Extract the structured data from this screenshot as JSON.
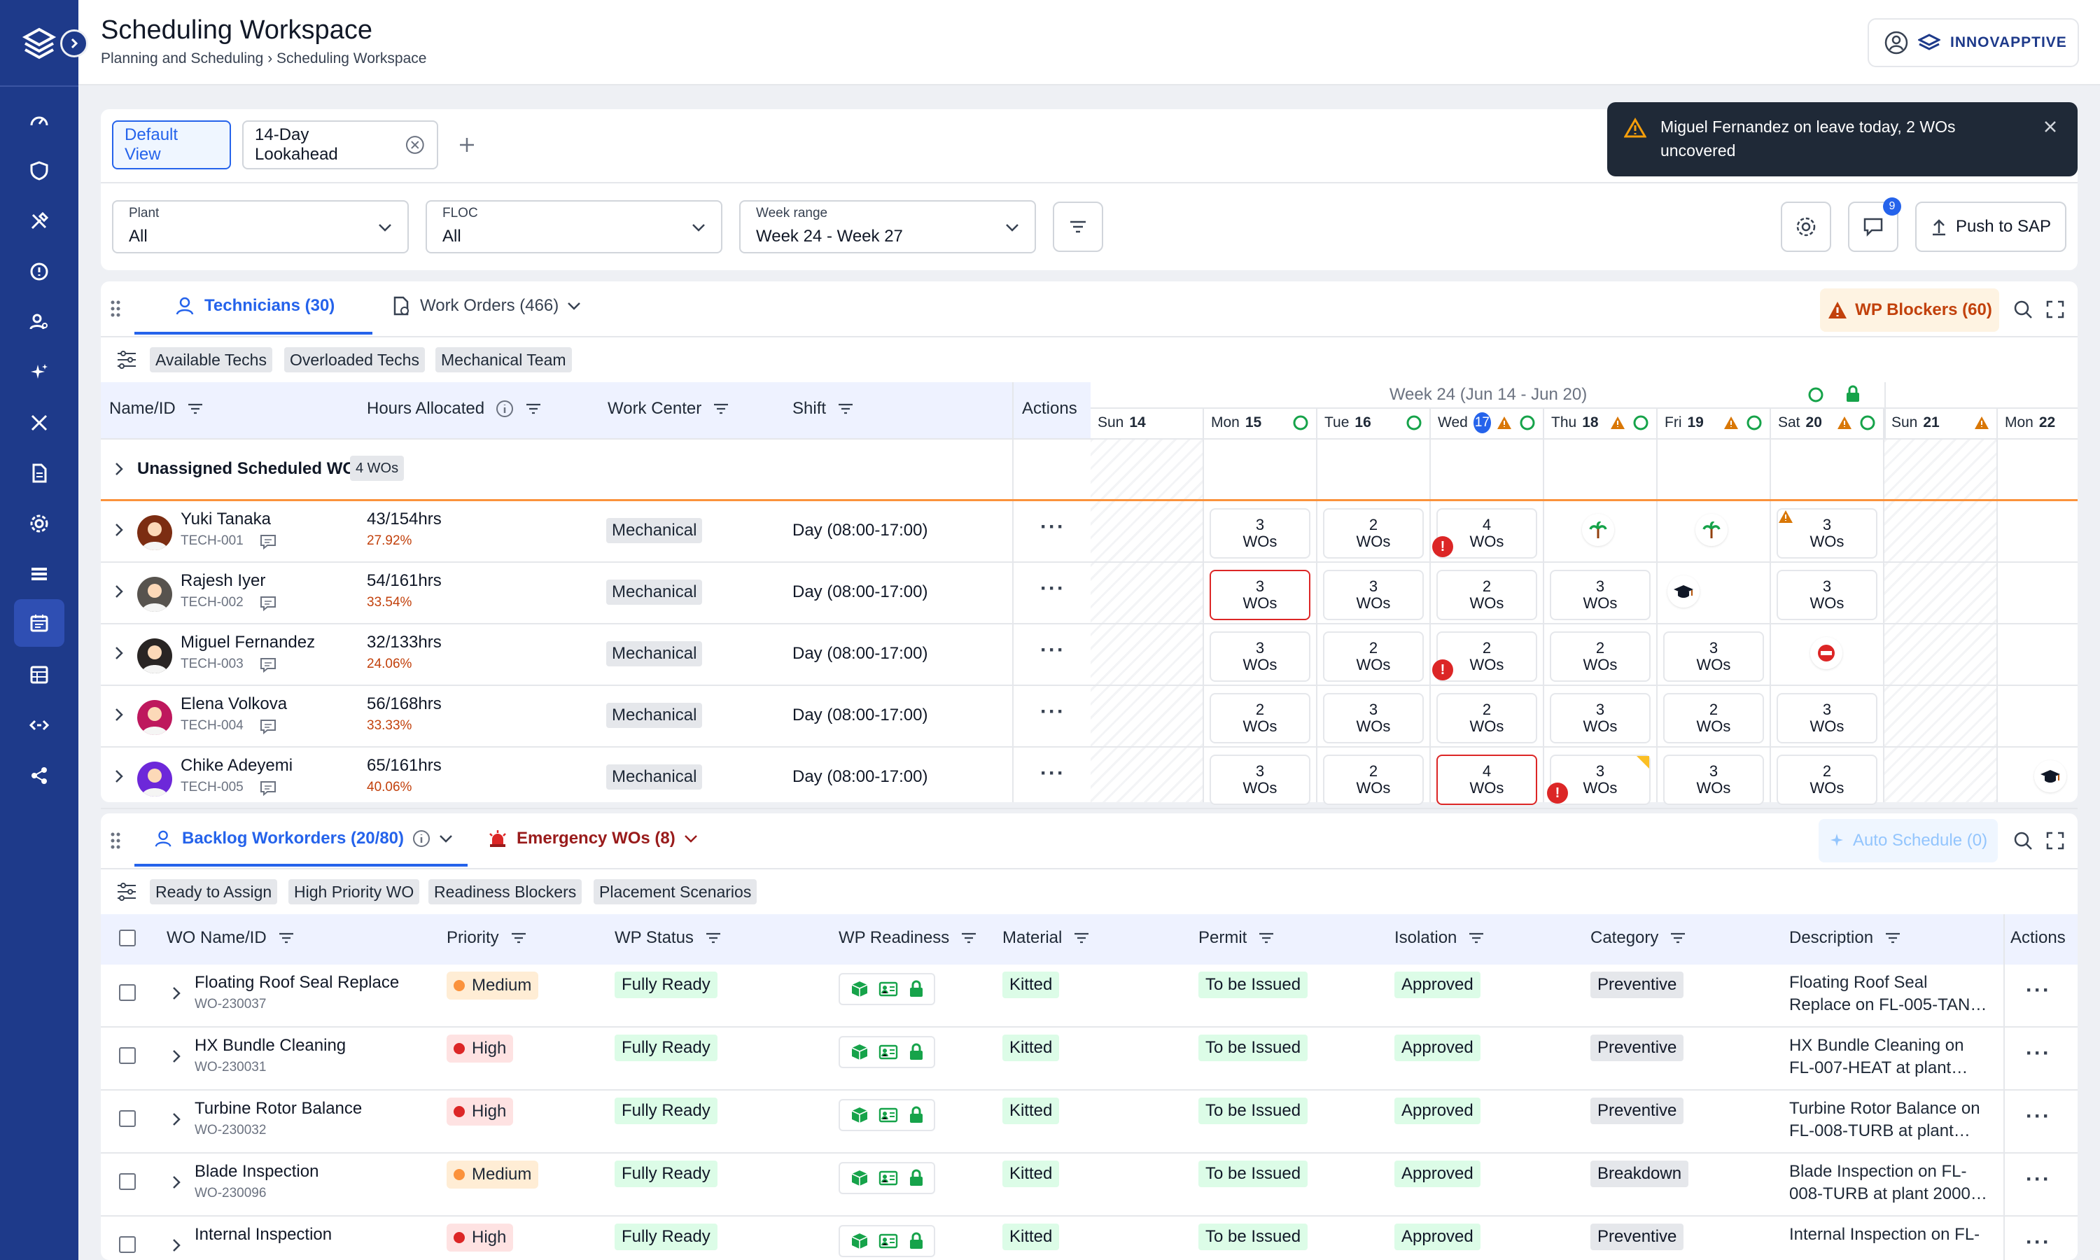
{
  "header": {
    "title": "Scheduling Workspace",
    "breadcrumb_parent": "Planning and Scheduling",
    "breadcrumb_current": "Scheduling Workspace",
    "brand": "INNOVAPPTIVE"
  },
  "toast": {
    "message_line1": "Miguel Fernandez on leave today, 2 WOs",
    "message_line2": "uncovered"
  },
  "sidebar": {
    "items": [
      "dashboard-icon",
      "shield-icon",
      "tools-icon",
      "alert-icon",
      "users-icon",
      "sparkle-icon",
      "wrench-icon",
      "document-icon",
      "settings-icon",
      "list-icon",
      "calendar-icon",
      "table-icon",
      "code-icon",
      "share-icon"
    ],
    "active": "calendar-icon"
  },
  "views": {
    "default": "Default View",
    "lookahead": "14-Day Lookahead"
  },
  "filters": {
    "plant_label": "Plant",
    "plant_value": "All",
    "floc_label": "FLOC",
    "floc_value": "All",
    "week_label": "Week range",
    "week_value": "Week 24 - Week 27",
    "messages_count": "9",
    "push": "Push to SAP"
  },
  "tech_section": {
    "tab_technicians": "Technicians (30)",
    "tab_work_orders": "Work Orders (466)",
    "blockers": "WP Blockers (60)",
    "chips": [
      "Available Techs",
      "Overloaded Techs",
      "Mechanical Team"
    ],
    "columns": {
      "name": "Name/ID",
      "hours": "Hours Allocated",
      "work_center": "Work Center",
      "shift": "Shift",
      "actions": "Actions"
    },
    "week_label": "Week 24 (Jun 14 - Jun 20)",
    "days": [
      {
        "name": "Sun",
        "num": "14"
      },
      {
        "name": "Mon",
        "num": "15"
      },
      {
        "name": "Tue",
        "num": "16"
      },
      {
        "name": "Wed",
        "num": "17"
      },
      {
        "name": "Thu",
        "num": "18"
      },
      {
        "name": "Fri",
        "num": "19"
      },
      {
        "name": "Sat",
        "num": "20"
      },
      {
        "name": "Sun",
        "num": "21"
      },
      {
        "name": "Mon",
        "num": "22"
      }
    ],
    "unassigned_label": "Unassigned Scheduled WO",
    "unassigned_count": "4 WOs",
    "technicians": [
      {
        "name": "Yuki Tanaka",
        "id": "TECH-001",
        "hours": "43/154hrs",
        "pct": "27.92%",
        "wc": "Mechanical",
        "shift": "Day (08:00-17:00)"
      },
      {
        "name": "Rajesh Iyer",
        "id": "TECH-002",
        "hours": "54/161hrs",
        "pct": "33.54%",
        "wc": "Mechanical",
        "shift": "Day (08:00-17:00)"
      },
      {
        "name": "Miguel Fernandez",
        "id": "TECH-003",
        "hours": "32/133hrs",
        "pct": "24.06%",
        "wc": "Mechanical",
        "shift": "Day (08:00-17:00)"
      },
      {
        "name": "Elena Volkova",
        "id": "TECH-004",
        "hours": "56/168hrs",
        "pct": "33.33%",
        "wc": "Mechanical",
        "shift": "Day (08:00-17:00)"
      },
      {
        "name": "Chike Adeyemi",
        "id": "TECH-005",
        "hours": "65/161hrs",
        "pct": "40.06%",
        "wc": "Mechanical",
        "shift": "Day (08:00-17:00)"
      }
    ],
    "wo_unit": "WOs",
    "cells": [
      [
        "3",
        "2",
        "4",
        "",
        "",
        "3"
      ],
      [
        "3",
        "3",
        "2",
        "3",
        "",
        "3"
      ],
      [
        "3",
        "2",
        "2",
        "2",
        "3",
        ""
      ],
      [
        "2",
        "3",
        "2",
        "3",
        "2",
        "3"
      ],
      [
        "3",
        "2",
        "4",
        "3",
        "3",
        "2"
      ]
    ]
  },
  "backlog": {
    "tab_backlog": "Backlog Workorders (20/80)",
    "tab_emergency": "Emergency WOs (8)",
    "auto_schedule": "Auto Schedule (0)",
    "chips": [
      "Ready to Assign",
      "High Priority WO",
      "Readiness Blockers",
      "Placement Scenarios"
    ],
    "columns": {
      "wo": "WO Name/ID",
      "priority": "Priority",
      "wp_status": "WP Status",
      "wp_readiness": "WP Readiness",
      "material": "Material",
      "permit": "Permit",
      "isolation": "Isolation",
      "category": "Category",
      "description": "Description",
      "actions": "Actions"
    },
    "rows": [
      {
        "name": "Floating Roof Seal Replace",
        "id": "WO-230037",
        "priority": "Medium",
        "status": "Fully Ready",
        "material": "Kitted",
        "permit": "To be Issued",
        "isolation": "Approved",
        "category": "Preventive",
        "desc1": "Floating Roof Seal",
        "desc2": "Replace on FL-005-TAN…"
      },
      {
        "name": "HX Bundle Cleaning",
        "id": "WO-230031",
        "priority": "High",
        "status": "Fully Ready",
        "material": "Kitted",
        "permit": "To be Issued",
        "isolation": "Approved",
        "category": "Preventive",
        "desc1": "HX Bundle Cleaning on",
        "desc2": "FL-007-HEAT at plant…"
      },
      {
        "name": "Turbine Rotor Balance",
        "id": "WO-230032",
        "priority": "High",
        "status": "Fully Ready",
        "material": "Kitted",
        "permit": "To be Issued",
        "isolation": "Approved",
        "category": "Preventive",
        "desc1": "Turbine Rotor Balance on",
        "desc2": "FL-008-TURB at plant…"
      },
      {
        "name": "Blade Inspection",
        "id": "WO-230096",
        "priority": "Medium",
        "status": "Fully Ready",
        "material": "Kitted",
        "permit": "To be Issued",
        "isolation": "Approved",
        "category": "Breakdown",
        "desc1": "Blade Inspection on FL-",
        "desc2": "008-TURB at plant 2000-…"
      },
      {
        "name": "Internal Inspection",
        "id": "",
        "priority": "High",
        "status": "Fully Ready",
        "material": "Kitted",
        "permit": "To be Issued",
        "isolation": "Approved",
        "category": "Preventive",
        "desc1": "Internal Inspection on FL-",
        "desc2": ""
      }
    ]
  },
  "colors": {
    "brand": "#1e3a8a",
    "accent": "#2563eb",
    "medium": "#fb923c",
    "high": "#dc2626",
    "ready": "#16a34a"
  }
}
